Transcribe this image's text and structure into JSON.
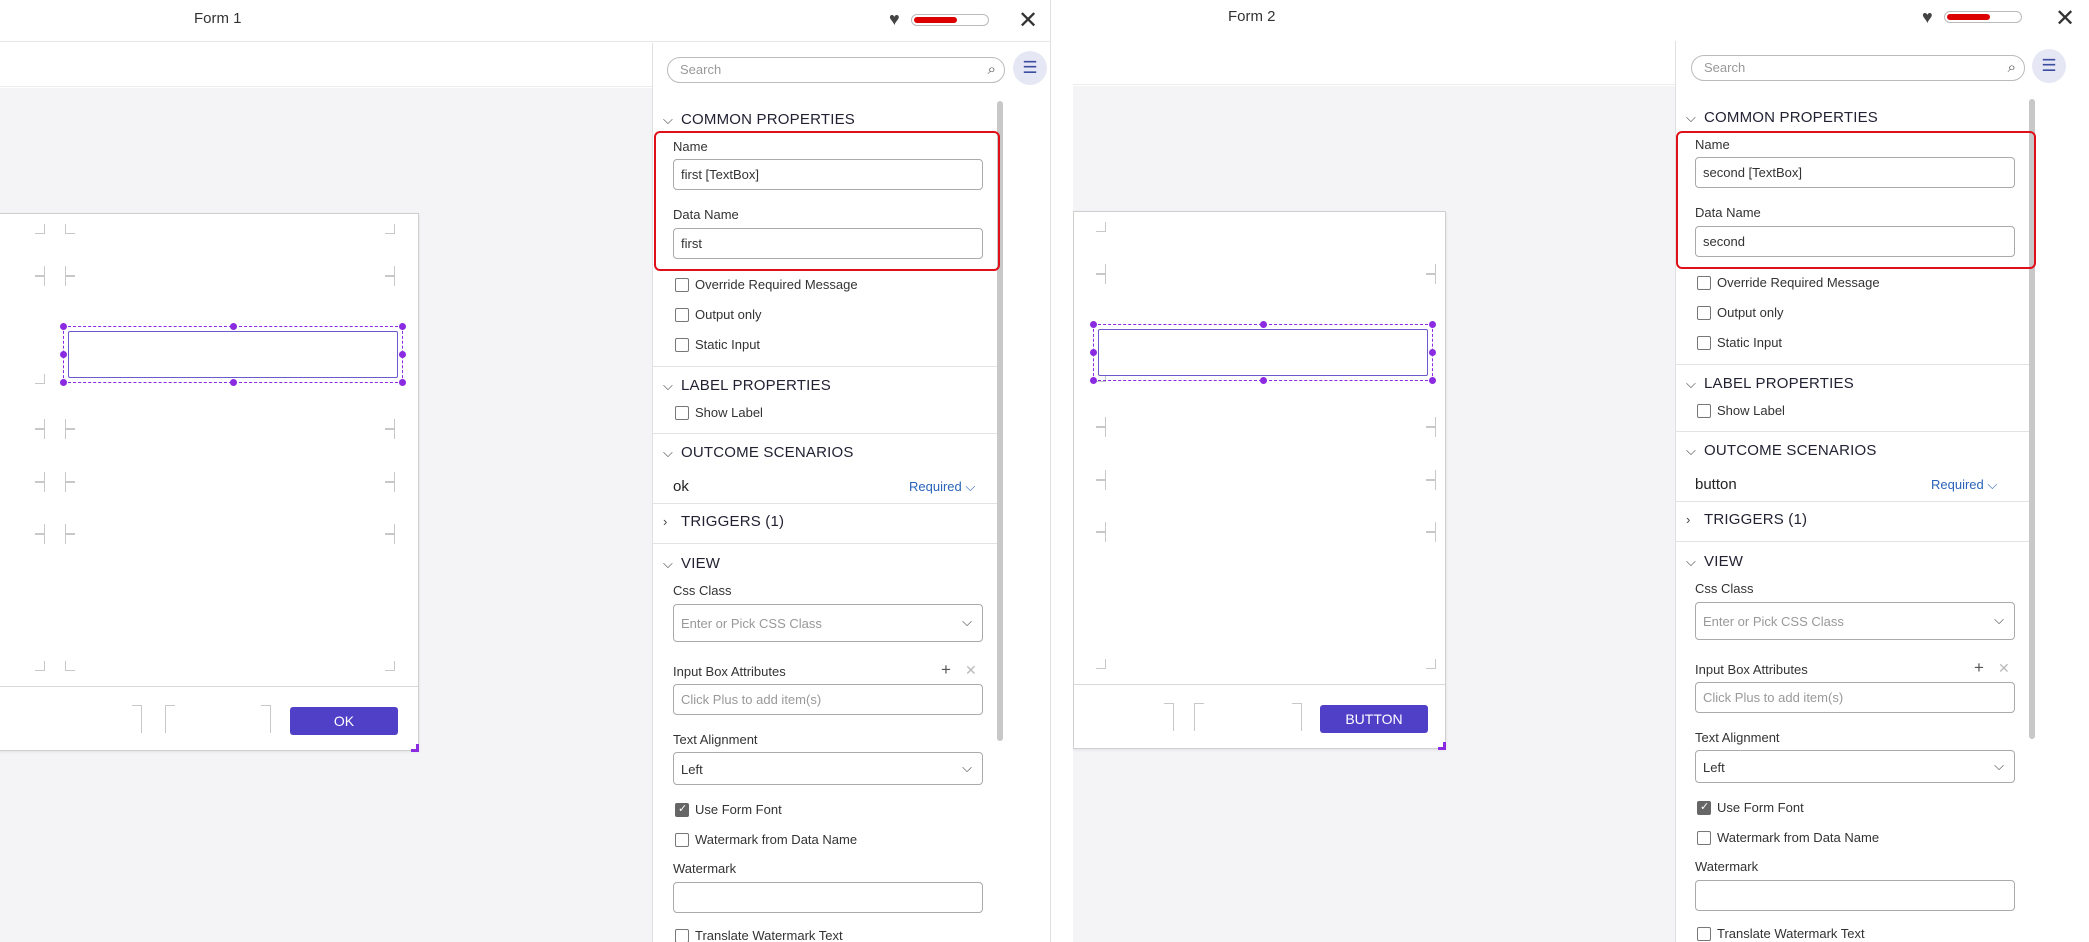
{
  "form1": {
    "title": "Form 1",
    "progress_fraction": 0.7,
    "footer_button": "OK",
    "search_placeholder": "Search",
    "sections": {
      "common": "COMMON PROPERTIES",
      "label": "LABEL PROPERTIES",
      "outcome": "OUTCOME SCENARIOS",
      "triggers": "TRIGGERS (1)",
      "view": "VIEW"
    },
    "name_label": "Name",
    "name_value": "first [TextBox]",
    "data_name_label": "Data Name",
    "data_name_value": "first",
    "checkboxes": [
      "Override Required Message",
      "Output only",
      "Static Input"
    ],
    "show_label": "Show Label",
    "outcome_name": "ok",
    "outcome_required": "Required",
    "css_class_label": "Css Class",
    "css_class_placeholder": "Enter or Pick CSS Class",
    "input_attrs_label": "Input Box Attributes",
    "input_attrs_placeholder": "Click Plus to add item(s)",
    "text_align_label": "Text Alignment",
    "text_align_value": "Left",
    "use_form_font": "Use Form Font",
    "watermark_from_data": "Watermark from Data Name",
    "watermark_label": "Watermark",
    "translate_watermark": "Translate Watermark Text"
  },
  "form2": {
    "title": "Form 2",
    "progress_fraction": 0.7,
    "footer_button": "BUTTON",
    "search_placeholder": "Search",
    "sections": {
      "common": "COMMON PROPERTIES",
      "label": "LABEL PROPERTIES",
      "outcome": "OUTCOME SCENARIOS",
      "triggers": "TRIGGERS (1)",
      "view": "VIEW"
    },
    "name_label": "Name",
    "name_value": "second [TextBox]",
    "data_name_label": "Data Name",
    "data_name_value": "second",
    "checkboxes": [
      "Override Required Message",
      "Output only",
      "Static Input"
    ],
    "show_label": "Show Label",
    "outcome_name": "button",
    "outcome_required": "Required",
    "css_class_label": "Css Class",
    "css_class_placeholder": "Enter or Pick CSS Class",
    "input_attrs_label": "Input Box Attributes",
    "input_attrs_placeholder": "Click Plus to add item(s)",
    "text_align_label": "Text Alignment",
    "text_align_value": "Left",
    "use_form_font": "Use Form Font",
    "watermark_from_data": "Watermark from Data Name",
    "watermark_label": "Watermark",
    "translate_watermark": "Translate Watermark Text"
  },
  "icons": {
    "heart": "heart-icon",
    "close": "close-icon",
    "search": "search-icon",
    "settings": "sliders-icon"
  },
  "colors": {
    "accent": "#5040c8",
    "highlight": "#e0101a",
    "selection": "#8a2be2",
    "progress": "#dd0000"
  }
}
